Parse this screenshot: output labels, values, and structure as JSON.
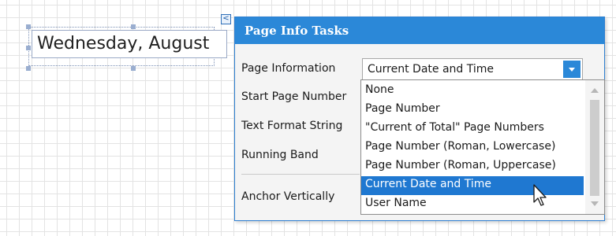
{
  "control": {
    "text": "Wednesday, August"
  },
  "smart_tag": {
    "glyph": "<"
  },
  "panel": {
    "title": "Page Info Tasks",
    "labels": {
      "page_information": "Page Information",
      "start_page_number": "Start Page Number",
      "text_format_string": "Text Format String",
      "running_band": "Running Band",
      "anchor_vertically": "Anchor Vertically"
    },
    "page_information_value": "Current Date and Time"
  },
  "dropdown": {
    "options": [
      "None",
      "Page Number",
      "\"Current of Total\" Page Numbers",
      "Page Number (Roman, Lowercase)",
      "Page Number (Roman, Uppercase)",
      "Current Date and Time",
      "User Name"
    ],
    "selected": "Current Date and Time"
  },
  "colors": {
    "accent": "#2b88d8",
    "selected_row": "#1f78d1",
    "panel_bg": "#f4f4f4"
  },
  "icons": {
    "smart_tag": "chevron-left-icon",
    "combo_button": "chevron-down-icon",
    "cursor": "mouse-pointer-icon"
  }
}
